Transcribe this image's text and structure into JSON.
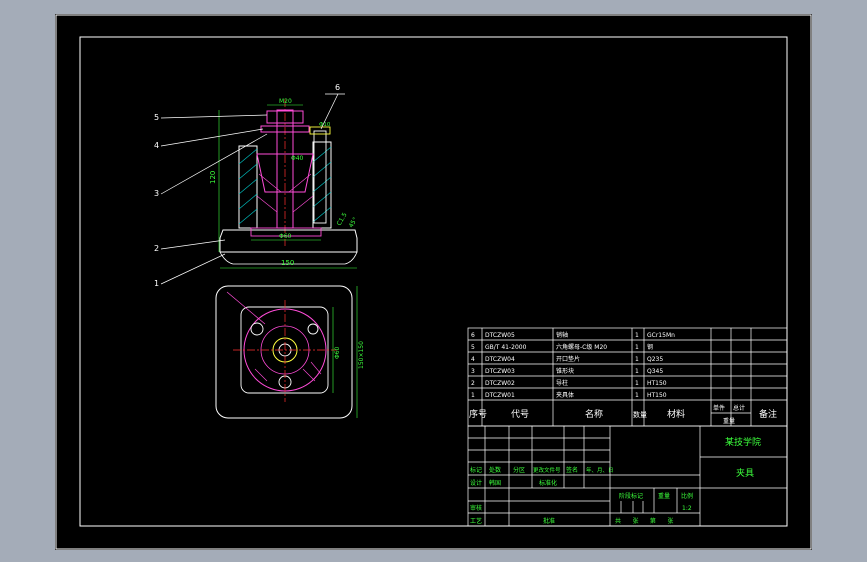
{
  "colors": {
    "background": "#000000",
    "frame": "#ffffff",
    "outline": "#ffffff",
    "section": "#ff4cd8",
    "dimension": "#3cff3c",
    "hatch": "#00bcbc",
    "centerline": "#ff3030",
    "part": "#ffff40",
    "cad_chrome": "#a4acb8"
  },
  "front_view": {
    "balloons": [
      "5",
      "4",
      "3",
      "2",
      "1",
      "6"
    ],
    "dims": {
      "top_dia": "M20",
      "right_dia": "Φ10",
      "mid_dia": "Φ40",
      "bottom_dia": "Φ60",
      "overall_width": "150",
      "height": "120",
      "chamfer": "C1.5",
      "angle": "45°"
    }
  },
  "top_view": {
    "dims": {
      "right_inner": "Φ60",
      "right_outer": "150×150"
    }
  },
  "bom": {
    "rows": [
      {
        "no": "6",
        "code": "DTCZW05",
        "name": "销轴",
        "qty": "1",
        "material": "GCr15Mn"
      },
      {
        "no": "5",
        "code": "GB/T 41-2000",
        "name": "六角螺母-C级 M20",
        "qty": "1",
        "material": "钢"
      },
      {
        "no": "4",
        "code": "DTCZW04",
        "name": "开口垫片",
        "qty": "1",
        "material": "Q235"
      },
      {
        "no": "3",
        "code": "DTCZW03",
        "name": "锥形块",
        "qty": "1",
        "material": "Q345"
      },
      {
        "no": "2",
        "code": "DTCZW02",
        "name": "导柱",
        "qty": "1",
        "material": "HT150"
      },
      {
        "no": "1",
        "code": "DTCZW01",
        "name": "夹具体",
        "qty": "1",
        "material": "HT150"
      }
    ],
    "header": {
      "no": "序号",
      "code": "代号",
      "name": "名称",
      "qty": "数量",
      "material": "材料",
      "single": "单件",
      "total": "总计",
      "weight": "重量",
      "remark": "备注"
    }
  },
  "title_block": {
    "school": "某技学院",
    "drawing_name": "夹具",
    "rev_labels": [
      "标记",
      "处数",
      "分区",
      "更改文件号",
      "签名",
      "年、月、日"
    ],
    "role_labels": [
      "设计",
      "标准化",
      "审核",
      "工艺",
      "批准"
    ],
    "signer": "韩国",
    "stage_label": "阶段标记",
    "weight_label": "重量",
    "scale_label": "比例",
    "scale": "1:2",
    "sheet_info": "共 张 第 张"
  }
}
